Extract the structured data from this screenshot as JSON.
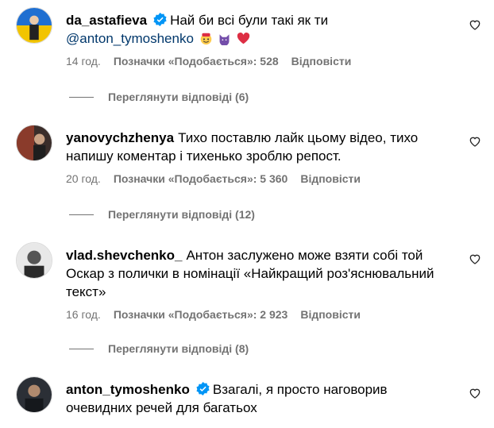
{
  "comments": [
    {
      "username": "da_astafieva",
      "verified": true,
      "text": "Най би всі були такі як ти",
      "mention": "@anton_tymoshenko",
      "emojis": [
        "face-with-hearts-emoji",
        "purple-cat-emoji",
        "red-heart-emoji"
      ],
      "time": "14 год.",
      "likes": "Позначки «Подобається»: 528",
      "reply": "Відповісти",
      "view_replies": "Переглянути відповіді (6)"
    },
    {
      "username": "yanovychzhenya",
      "verified": false,
      "text": "Тихо поставлю лайк цьому відео, тихо напишу коментар і тихенько зроблю репост.",
      "time": "20 год.",
      "likes": "Позначки «Подобається»: 5 360",
      "reply": "Відповісти",
      "view_replies": "Переглянути відповіді (12)"
    },
    {
      "username": "vlad.shevchenko_",
      "verified": false,
      "text": "Антон заслужено може взяти собі той Оскар з полички в номінації «Найкращий роз'яснювальний текст»",
      "time": "16 год.",
      "likes": "Позначки «Подобається»: 2 923",
      "reply": "Відповісти",
      "view_replies": "Переглянути відповіді (8)"
    },
    {
      "username": "anton_tymoshenko",
      "verified": true,
      "text": "Взагалі, я просто наговорив очевидних речей для багатьох"
    }
  ],
  "colors": {
    "text": "#000000",
    "secondary": "#737373",
    "mention": "#00376b",
    "verified": "#0095f6"
  }
}
